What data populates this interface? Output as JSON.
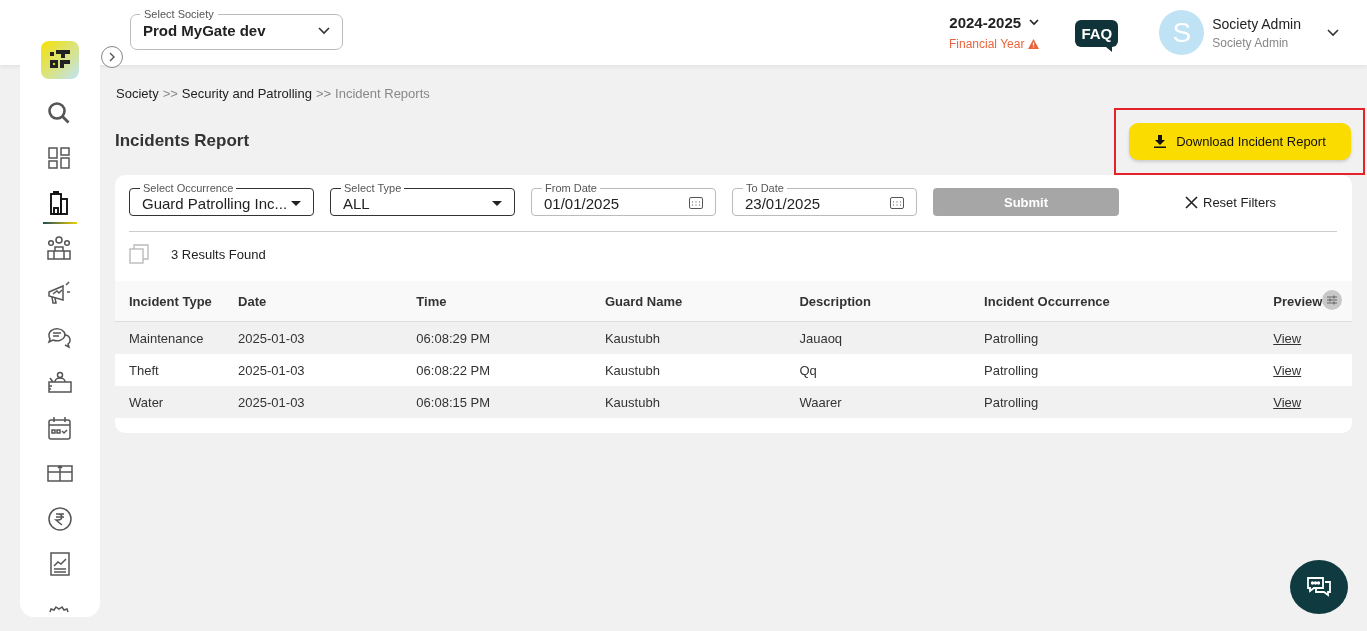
{
  "sidebar": {
    "items": [
      {
        "selected": false
      },
      {
        "selected": false
      },
      {
        "selected": true
      },
      {
        "selected": false
      },
      {
        "selected": false
      },
      {
        "selected": false
      },
      {
        "selected": false
      },
      {
        "selected": false
      },
      {
        "selected": false
      },
      {
        "selected": false
      },
      {
        "selected": false
      },
      {
        "selected": false
      }
    ]
  },
  "header": {
    "society_select": {
      "label": "Select Society",
      "value": "Prod MyGate dev"
    },
    "year": {
      "value": "2024-2025",
      "caption": "Financial Year"
    },
    "faq": "FAQ",
    "user": {
      "initial": "S",
      "name": "Society Admin",
      "role": "Society Admin"
    }
  },
  "breadcrumb": {
    "separator": ">>",
    "items": [
      {
        "label": "Society",
        "current": false
      },
      {
        "label": "Security and Patrolling",
        "current": false
      },
      {
        "label": "Incident Reports",
        "current": true
      }
    ]
  },
  "title": "Incidents Report",
  "download_button": {
    "label": "Download Incident Report",
    "highlighted": true
  },
  "filters": [
    {
      "kind": "select",
      "label": "Select Occurrence",
      "value": "Guard Patrolling Inc..."
    },
    {
      "kind": "select",
      "label": "Select Type",
      "value": "ALL"
    },
    {
      "kind": "date",
      "label": "From Date",
      "value": "01/01/2025"
    },
    {
      "kind": "date",
      "label": "To Date",
      "value": "23/01/2025"
    }
  ],
  "submit": {
    "label": "Submit",
    "disabled": true
  },
  "reset": "Reset Filters",
  "results": "3 Results Found",
  "table": {
    "columns": [
      "Incident Type",
      "Date",
      "Time",
      "Guard Name",
      "Description",
      "Incident Occurrence",
      "Preview"
    ],
    "rows": [
      {
        "cells": [
          "Maintenance",
          "2025-01-03",
          "06:08:29 PM",
          "Kaustubh",
          "Jauaoq",
          "Patrolling"
        ],
        "preview": "View"
      },
      {
        "cells": [
          "Theft",
          "2025-01-03",
          "06:08:22 PM",
          "Kaustubh",
          "Qq",
          "Patrolling"
        ],
        "preview": "View"
      },
      {
        "cells": [
          "Water",
          "2025-01-03",
          "06:08:15 PM",
          "Kaustubh",
          "Waarer",
          "Patrolling"
        ],
        "preview": "View"
      }
    ]
  }
}
